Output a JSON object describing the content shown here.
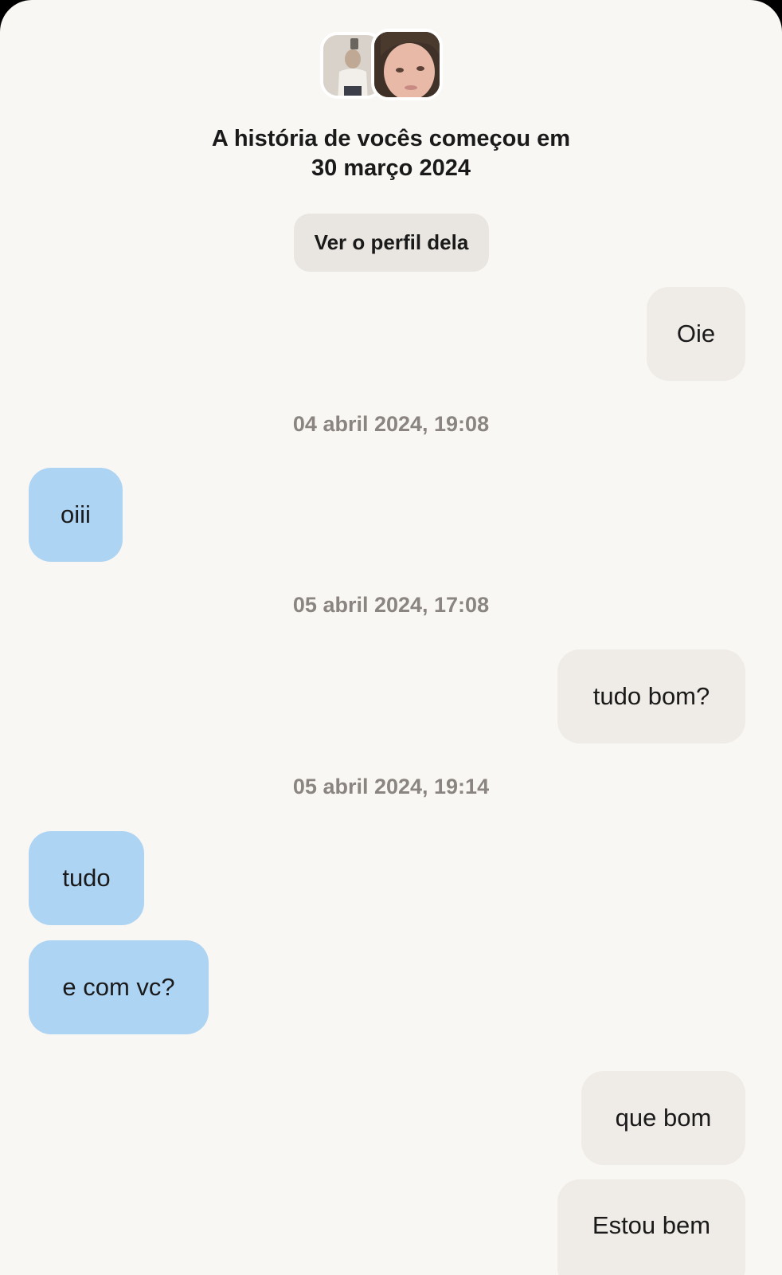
{
  "header": {
    "title_line1": "A história de vocês começou em",
    "title_line2": "30 março 2024",
    "profile_button_label": "Ver o perfil dela"
  },
  "chat": {
    "m1": {
      "text": "Oie",
      "side": "sent"
    },
    "t1": "04 abril 2024, 19:08",
    "m2": {
      "text": "oiii",
      "side": "received"
    },
    "t2": "05 abril 2024, 17:08",
    "m3": {
      "text": "tudo bom?",
      "side": "sent"
    },
    "t3": "05 abril 2024, 19:14",
    "m4": {
      "text": "tudo",
      "side": "received"
    },
    "m5": {
      "text": "e com vc?",
      "side": "received"
    },
    "m6": {
      "text": "que bom",
      "side": "sent"
    },
    "m7": {
      "text": "Estou bem",
      "side": "sent"
    }
  },
  "colors": {
    "background": "#f9f7f3",
    "sent_bubble": "#efebe6",
    "received_bubble": "#aed4f4",
    "timestamp_text": "#8a8580"
  }
}
